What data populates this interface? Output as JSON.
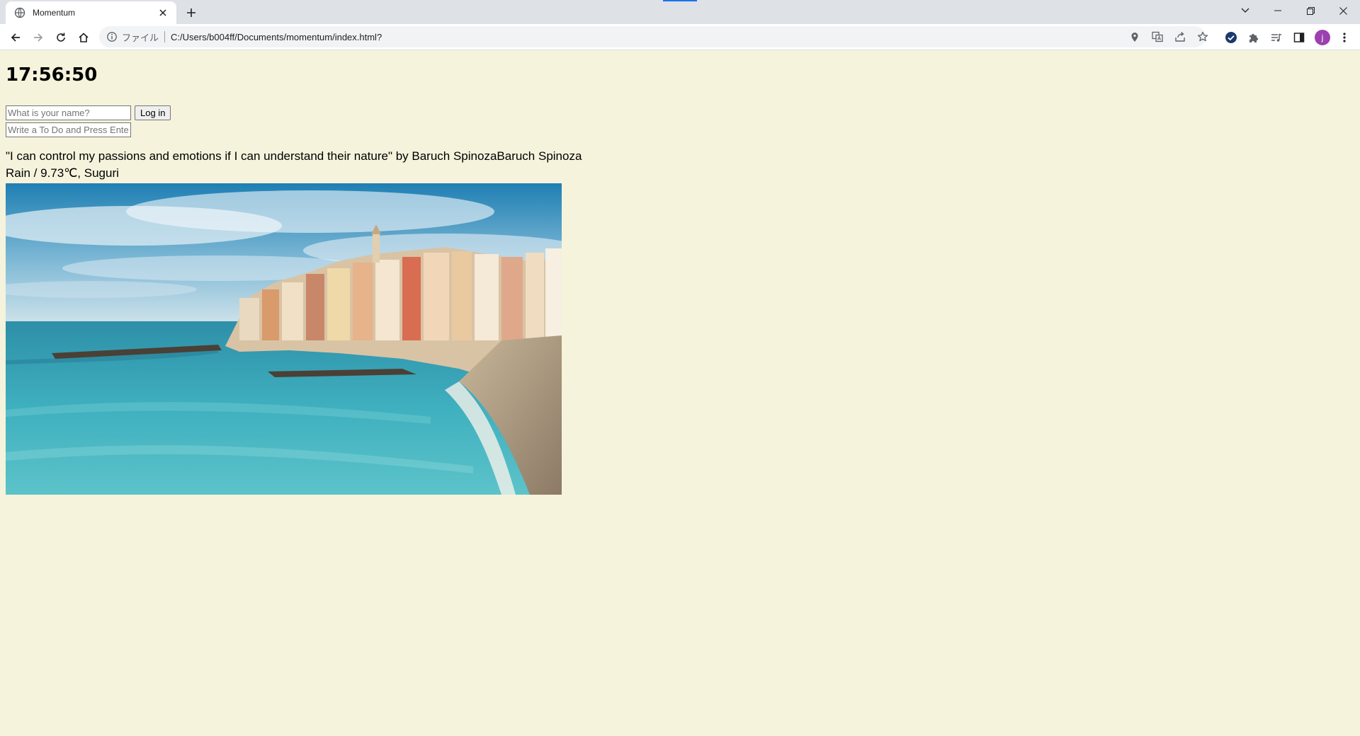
{
  "browser": {
    "tab_title": "Momentum",
    "omnibox": {
      "scheme_label": "ファイル",
      "url": "C:/Users/b004ff/Documents/momentum/index.html?"
    },
    "profile_initial": "j",
    "profile_color": "#9c3fb0"
  },
  "page": {
    "clock": "17:56:50",
    "login": {
      "name_placeholder": "What is your name?",
      "button_label": "Log in"
    },
    "todo": {
      "placeholder": "Write a To Do and Press Enter"
    },
    "quote": "\"I can control my passions and emotions if I can understand their nature\" by Baruch SpinozaBaruch Spinoza",
    "weather": "Rain / 9.73℃, Suguri",
    "background_color": "#f5f3dc"
  }
}
